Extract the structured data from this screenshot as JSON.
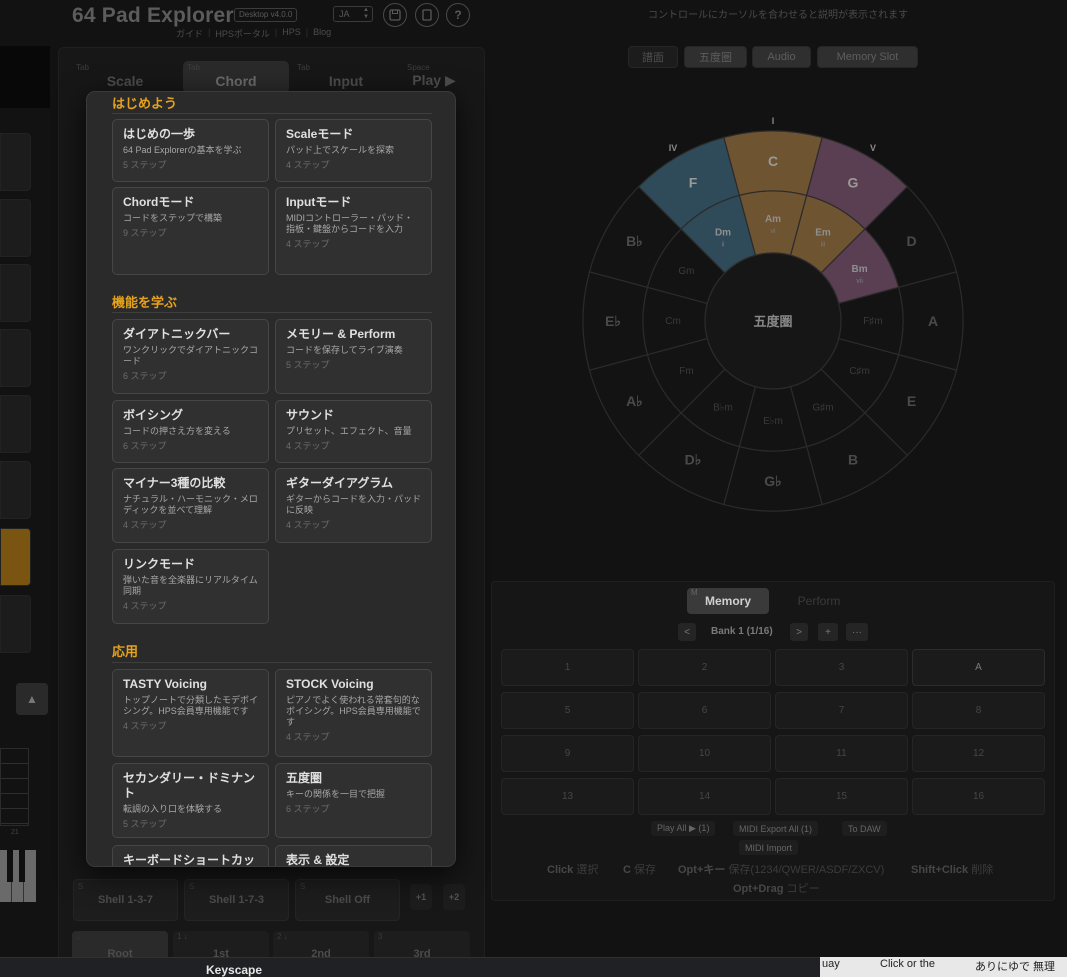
{
  "header": {
    "title": "64 Pad Explorer",
    "version": "Desktop v4.0.0",
    "lang": "JA",
    "lang_arrow": "▲▼",
    "links": [
      "ガイド",
      "HPSポータル",
      "HPS",
      "Blog"
    ],
    "hint": "コントロールにカーソルを合わせると説明が表示されます",
    "icons": [
      "save-icon",
      "tablet-icon",
      "help-icon"
    ]
  },
  "mode_tabs": [
    {
      "key": "Tab",
      "label": "Scale"
    },
    {
      "key": "Tab",
      "label": "Chord"
    },
    {
      "key": "Tab",
      "label": "Input"
    },
    {
      "key": "Space",
      "label": "Play ▶"
    }
  ],
  "view_tabs": [
    "譜面",
    "五度圏",
    "Audio",
    "Memory Slot"
  ],
  "circle": {
    "center_label": "五度圏",
    "roman": {
      "top": "I",
      "left": "IV",
      "right": "V"
    },
    "outer": [
      "C",
      "G",
      "D",
      "A",
      "E",
      "B",
      "G♭",
      "D♭",
      "A♭",
      "E♭",
      "B♭",
      "F"
    ],
    "inner": [
      "Am",
      "Em",
      "Bm",
      "F♯m",
      "C♯m",
      "G♯m",
      "E♭m",
      "B♭m",
      "Fm",
      "Cm",
      "Gm",
      "Dm"
    ],
    "inner_roman": {
      "Am": "vi",
      "Em": "iii",
      "Bm": "vii",
      "Dm": "ii"
    },
    "highlight_colors": {
      "tonic": "#6e5431",
      "dominant": "#5a3e52",
      "subdominant": "#2f4a58"
    }
  },
  "memory": {
    "tab_key": "M",
    "tab_memory": "Memory",
    "tab_perform": "Perform",
    "bank_label": "Bank 1 (1/16)",
    "prev": "<",
    "next": ">",
    "add": "+",
    "more": "···",
    "slots": [
      "1",
      "2",
      "3",
      "A",
      "5",
      "6",
      "7",
      "8",
      "9",
      "10",
      "11",
      "12",
      "13",
      "14",
      "15",
      "16"
    ],
    "actions": [
      "Play All ▶ (1)",
      "MIDI Export All (1)",
      "To DAW",
      "MIDI Import"
    ],
    "shortcut1": [
      {
        "key": "Click",
        "desc": "選択"
      },
      {
        "key": "C",
        "desc": "保存"
      },
      {
        "key": "Opt+キー",
        "desc": "保存(1234/QWER/ASDF/ZXCV)"
      },
      {
        "key": "Shift+Click",
        "desc": "削除"
      }
    ],
    "shortcut2": {
      "key": "Opt+Drag",
      "desc": "コピー"
    }
  },
  "voicing": {
    "buttons": [
      {
        "key": "S",
        "label": "Shell 1-3-7"
      },
      {
        "key": "S",
        "label": "Shell 1-7-3"
      },
      {
        "key": "S",
        "label": "Shell Off"
      }
    ],
    "plus1": "+1",
    "plus2": "+2",
    "inversions": [
      {
        "key": "↓",
        "label": "Root"
      },
      {
        "key": "1 ↓",
        "label": "1st"
      },
      {
        "key": "2 ↓",
        "label": "2nd"
      },
      {
        "key": "3",
        "label": "3rd"
      }
    ],
    "fret_label": "21"
  },
  "modal": {
    "sections": [
      {
        "title": "はじめよう",
        "cards": [
          {
            "title": "はじめの一歩",
            "desc": "64 Pad Explorerの基本を学ぶ",
            "steps": "5 ステップ"
          },
          {
            "title": "Scaleモード",
            "desc": "パッド上でスケールを探索",
            "steps": "4 ステップ"
          },
          {
            "title": "Chordモード",
            "desc": "コードをステップで構築",
            "steps": "9 ステップ"
          },
          {
            "title": "Inputモード",
            "desc": "MIDIコントローラー・パッド・指板・鍵盤からコードを入力",
            "steps": "4 ステップ"
          }
        ]
      },
      {
        "title": "機能を学ぶ",
        "cards": [
          {
            "title": "ダイアトニックバー",
            "desc": "ワンクリックでダイアトニックコード",
            "steps": "6 ステップ"
          },
          {
            "title": "メモリー & Perform",
            "desc": "コードを保存してライブ演奏",
            "steps": "5 ステップ"
          },
          {
            "title": "ボイシング",
            "desc": "コードの押さえ方を変える",
            "steps": "6 ステップ"
          },
          {
            "title": "サウンド",
            "desc": "プリセット、エフェクト、音量",
            "steps": "4 ステップ"
          },
          {
            "title": "マイナー3種の比較",
            "desc": "ナチュラル・ハーモニック・メロディックを並べて理解",
            "steps": "4 ステップ"
          },
          {
            "title": "ギターダイアグラム",
            "desc": "ギターからコードを入力・パッドに反映",
            "steps": "4 ステップ"
          },
          {
            "title": "リンクモード",
            "desc": "弾いた音を全楽器にリアルタイム同期",
            "steps": "4 ステップ"
          }
        ]
      },
      {
        "title": "応用",
        "cards": [
          {
            "title": "TASTY Voicing",
            "desc": "トップノートで分類したモデボイシング。HPS会員専用機能です",
            "steps": "4 ステップ"
          },
          {
            "title": "STOCK Voicing",
            "desc": "ピアノでよく使われる常套句的なボイシング。HPS会員専用機能です",
            "steps": "4 ステップ"
          },
          {
            "title": "セカンダリー・ドミナント",
            "desc": "転調の入り口を体験する",
            "steps": "5 ステップ"
          },
          {
            "title": "五度圏",
            "desc": "キーの関係を一目で把握",
            "steps": "6 ステップ"
          },
          {
            "title": "キーボードショートカッ",
            "desc": "",
            "steps": ""
          },
          {
            "title": "表示 & 設定",
            "desc": "",
            "steps": ""
          }
        ]
      }
    ]
  },
  "taskbar": {
    "title": "Keyscape",
    "frag1": "uay",
    "frag2": "Click or the",
    "frag3": "ありにゆで 無理"
  }
}
